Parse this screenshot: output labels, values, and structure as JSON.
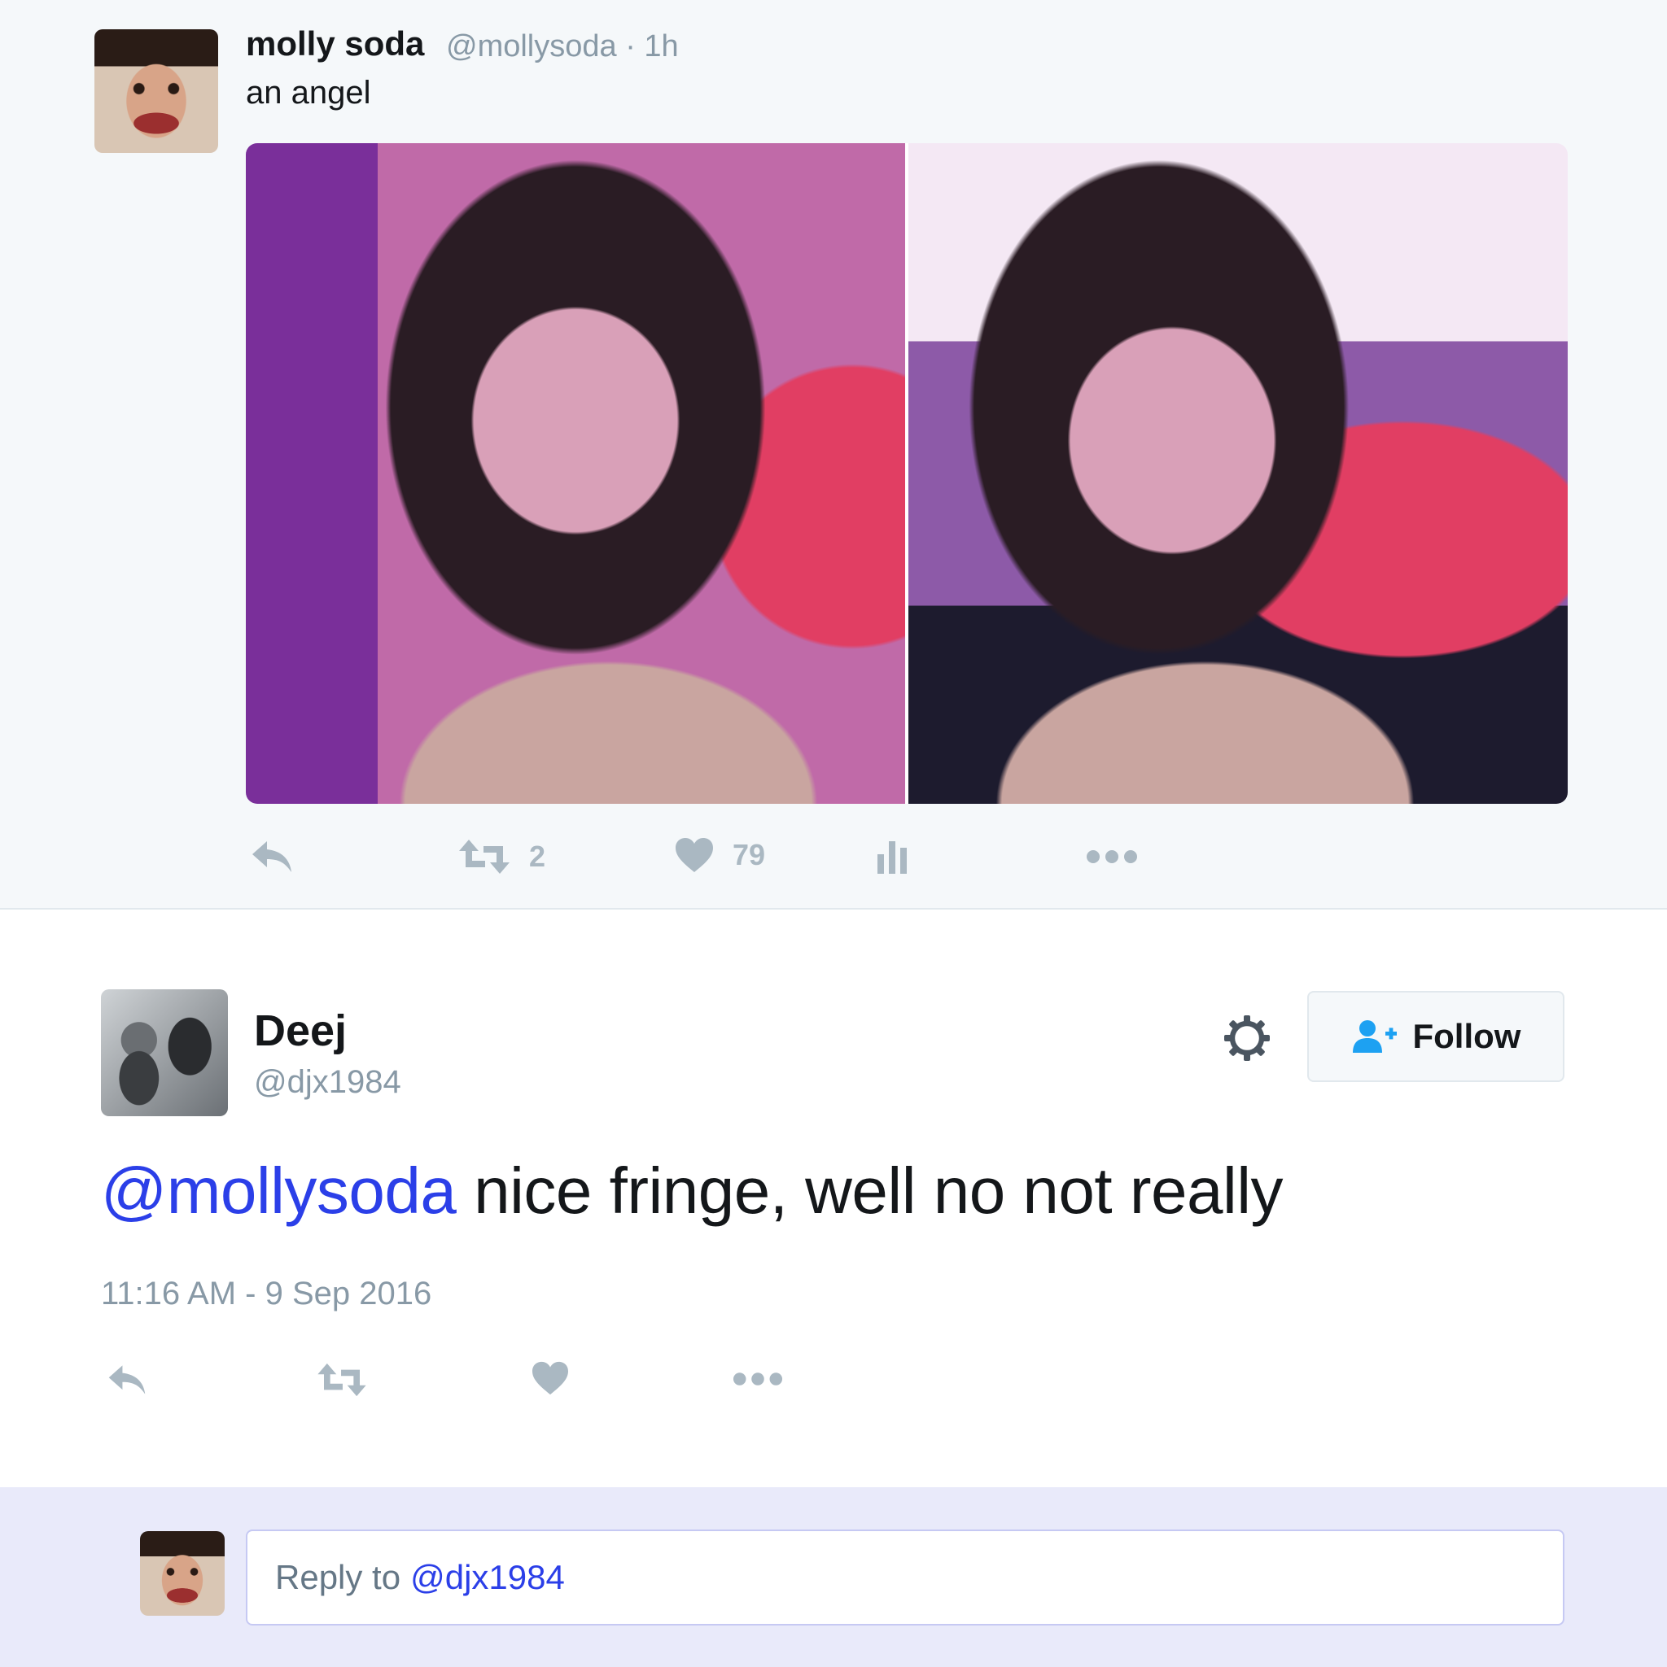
{
  "parent_tweet": {
    "name": "molly soda",
    "handle_time": "@mollysoda · 1h",
    "text": "an angel",
    "retweet_count": "2",
    "like_count": "79",
    "icons": [
      "reply-icon",
      "retweet-icon",
      "heart-icon",
      "analytics-icon",
      "more-icon"
    ]
  },
  "tweet": {
    "name": "Deej",
    "handle": "@djx1984",
    "mention": "@mollysoda",
    "text": " nice fringe, well no not really",
    "timestamp": "11:16 AM - 9 Sep 2016",
    "follow_label": "Follow",
    "icons": [
      "gear-icon",
      "add-user-icon",
      "reply-icon",
      "retweet-icon",
      "heart-icon",
      "more-icon"
    ]
  },
  "reply_box": {
    "prefix": "Reply to",
    "mention": "@djx1984"
  },
  "colors": {
    "parent_bg": "#f5f8fa",
    "mention": "#2b3fe8",
    "icon_gray": "#aab8c2",
    "follow_blue": "#1da1f2",
    "reply_bar_bg": "#e9eafa"
  }
}
